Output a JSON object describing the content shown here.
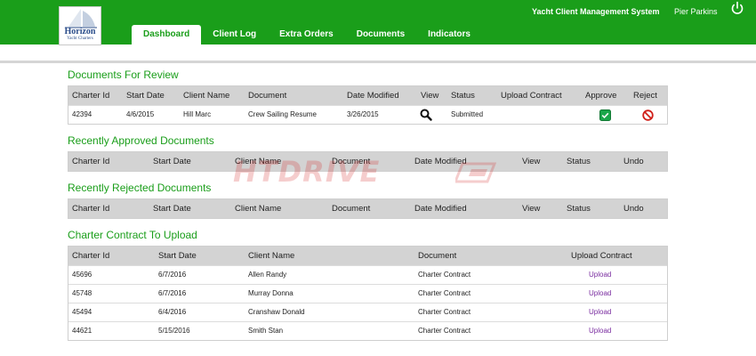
{
  "header": {
    "logo_name": "Horizon",
    "logo_subtitle": "Yacht Charters",
    "system_name": "Yacht Client Management System",
    "user_name": "Pier Parkins",
    "tabs": [
      {
        "label": "Dashboard",
        "active": true
      },
      {
        "label": "Client Log"
      },
      {
        "label": "Extra Orders"
      },
      {
        "label": "Documents"
      },
      {
        "label": "Indicators"
      }
    ]
  },
  "colors": {
    "brand_green": "#1a9e1a",
    "link_purple": "#7a2da0",
    "reject_red": "#d0201a"
  },
  "review": {
    "title": "Documents For Review",
    "headers": {
      "charter_id": "Charter Id",
      "start_date": "Start Date",
      "client_name": "Client Name",
      "document": "Document",
      "date_modified": "Date Modified",
      "view": "View",
      "status": "Status",
      "upload_contract": "Upload Contract",
      "approve": "Approve",
      "reject": "Reject"
    },
    "rows": [
      {
        "charter_id": "42394",
        "start_date": "4/6/2015",
        "client_name": "Hill Marc",
        "document": "Crew Sailing Resume",
        "date_modified": "3/26/2015",
        "status": "Submitted",
        "view_icon": "magnifier-icon",
        "approve_icon": "check-icon",
        "reject_icon": "no-entry-icon"
      }
    ]
  },
  "approved": {
    "title": "Recently Approved Documents",
    "headers": {
      "charter_id": "Charter Id",
      "start_date": "Start Date",
      "client_name": "Client Name",
      "document": "Document",
      "date_modified": "Date Modified",
      "view": "View",
      "status": "Status",
      "undo": "Undo"
    }
  },
  "rejected": {
    "title": "Recently Rejected Documents",
    "headers": {
      "charter_id": "Charter Id",
      "start_date": "Start Date",
      "client_name": "Client Name",
      "document": "Document",
      "date_modified": "Date Modified",
      "view": "View",
      "status": "Status",
      "undo": "Undo"
    }
  },
  "contracts": {
    "title": "Charter Contract To Upload",
    "headers": {
      "charter_id": "Charter Id",
      "start_date": "Start Date",
      "client_name": "Client Name",
      "document": "Document",
      "upload_contract": "Upload Contract"
    },
    "rows": [
      {
        "charter_id": "45696",
        "start_date": "6/7/2016",
        "client_name": "Allen Randy",
        "document": "Charter Contract",
        "action": "Upload"
      },
      {
        "charter_id": "45748",
        "start_date": "6/7/2016",
        "client_name": "Murray Donna",
        "document": "Charter Contract",
        "action": "Upload"
      },
      {
        "charter_id": "45494",
        "start_date": "6/4/2016",
        "client_name": "Cranshaw Donald",
        "document": "Charter Contract",
        "action": "Upload"
      },
      {
        "charter_id": "44621",
        "start_date": "5/15/2016",
        "client_name": "Smith Stan",
        "document": "Charter Contract",
        "action": "Upload"
      }
    ]
  },
  "watermark": {
    "text": "HTDRIVE"
  }
}
